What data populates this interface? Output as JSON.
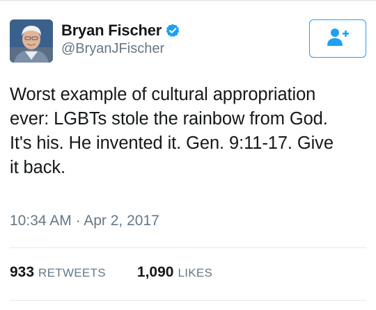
{
  "tweet": {
    "author": {
      "display_name": "Bryan Fischer",
      "handle": "@BryanJFischer",
      "verified": true,
      "avatar_icon": "profile-photo"
    },
    "follow_button": {
      "icon": "add-user-icon",
      "accent_color": "#1da1f2"
    },
    "text_lines": [
      "Worst example of cultural appropriation",
      "ever: LGBTs stole the rainbow from God.",
      "It's his. He invented it. Gen. 9:11-17. Give",
      "it back."
    ],
    "timestamp": "10:34 AM · Apr 2, 2017",
    "stats": {
      "retweets_count": "933",
      "retweets_label": "RETWEETS",
      "likes_count": "1,090",
      "likes_label": "LIKES"
    }
  },
  "colors": {
    "text_primary": "#14171a",
    "text_secondary": "#657786",
    "accent": "#1da1f2",
    "divider": "#e1e8ed"
  }
}
